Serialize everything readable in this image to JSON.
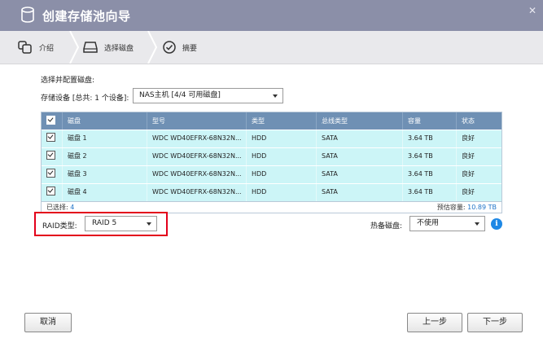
{
  "window": {
    "title": "创建存储池向导"
  },
  "steps": [
    {
      "label": "介绍",
      "icon": "intro-icon"
    },
    {
      "label": "选择磁盘",
      "icon": "disk-icon"
    },
    {
      "label": "摘要",
      "icon": "check-circle-icon"
    }
  ],
  "form": {
    "select_label": "选择并配置磁盘:",
    "device_label": "存储设备 [总共: 1 个设备]:",
    "device_value": "NAS主机 [4/4 可用磁盘]"
  },
  "table": {
    "headers": [
      "磁盘",
      "型号",
      "类型",
      "总线类型",
      "容量",
      "状态"
    ],
    "rows": [
      {
        "checked": true,
        "disk": "磁盘 1",
        "model": "WDC WD40EFRX-68N32N...",
        "type": "HDD",
        "bus": "SATA",
        "capacity": "3.64 TB",
        "status": "良好"
      },
      {
        "checked": true,
        "disk": "磁盘 2",
        "model": "WDC WD40EFRX-68N32N...",
        "type": "HDD",
        "bus": "SATA",
        "capacity": "3.64 TB",
        "status": "良好"
      },
      {
        "checked": true,
        "disk": "磁盘 3",
        "model": "WDC WD40EFRX-68N32N...",
        "type": "HDD",
        "bus": "SATA",
        "capacity": "3.64 TB",
        "status": "良好"
      },
      {
        "checked": true,
        "disk": "磁盘 4",
        "model": "WDC WD40EFRX-68N32N...",
        "type": "HDD",
        "bus": "SATA",
        "capacity": "3.64 TB",
        "status": "良好"
      }
    ],
    "footer": {
      "selected_label": "已选择:",
      "selected_value": "4",
      "capacity_label": "预估容量:",
      "capacity_value": "10.89 TB"
    }
  },
  "raid": {
    "label": "RAID类型:",
    "value": "RAID 5"
  },
  "spare": {
    "label": "热备磁盘:",
    "value": "不使用"
  },
  "buttons": {
    "cancel": "取消",
    "prev": "上一步",
    "next": "下一步"
  },
  "colors": {
    "titlebar": "#8b8fa8",
    "table_header": "#6f90b4",
    "row_bg": "#ccf5f7",
    "highlight": "#e3001b",
    "accent": "#1e73c8"
  }
}
